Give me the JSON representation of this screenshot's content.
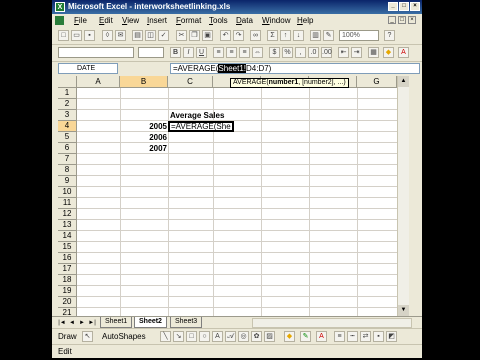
{
  "window": {
    "app_title": "Microsoft Excel - interworksheetlinking.xls"
  },
  "menu": [
    "File",
    "Edit",
    "View",
    "Insert",
    "Format",
    "Tools",
    "Data",
    "Window",
    "Help"
  ],
  "toolbar": {
    "zoom": "100%"
  },
  "formula_bar": {
    "name_box": "DATE",
    "formula_prefix": "=AVERAGE(",
    "formula_highlight": "Sheet1!",
    "formula_suffix": "D4:D7)"
  },
  "tooltip": {
    "fn": "AVERAGE(",
    "arg1": "number1",
    "rest": ", [number2], ...)"
  },
  "columns": [
    "A",
    "B",
    "C",
    "D",
    "E",
    "F",
    "G"
  ],
  "rows": [
    "1",
    "2",
    "3",
    "4",
    "5",
    "6",
    "7",
    "8",
    "9",
    "10",
    "11",
    "12",
    "13",
    "14",
    "15",
    "16",
    "17",
    "18",
    "19",
    "20",
    "21"
  ],
  "cells": {
    "title": "Average Sales",
    "year_2005": "2005",
    "year_2006": "2006",
    "year_2007": "2007",
    "editing": "=AVERAGE(She"
  },
  "sheets": [
    "Sheet1",
    "Sheet2",
    "Sheet3"
  ],
  "active_sheet": "Sheet2",
  "drawbar": {
    "draw": "Draw",
    "autoshapes": "AutoShapes"
  },
  "status": {
    "mode": "Edit"
  }
}
